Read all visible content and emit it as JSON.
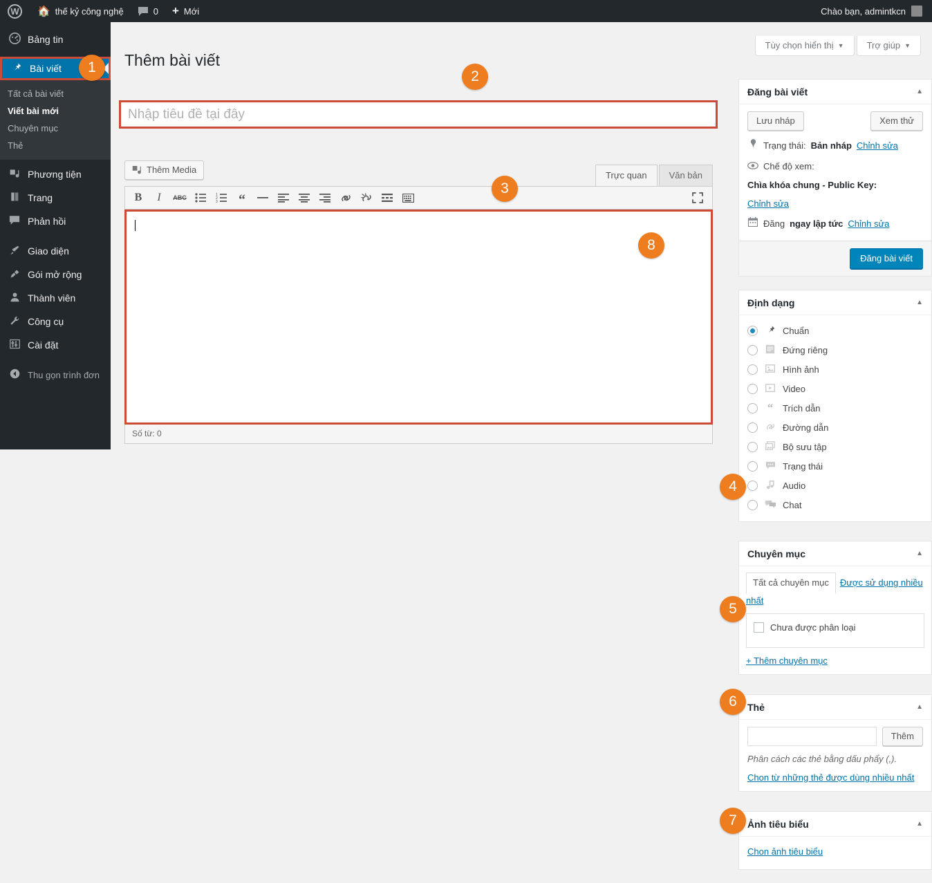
{
  "adminbar": {
    "logo_icon": "wordpress-logo-icon",
    "site_icon": "home-icon",
    "site_name": "thế kỷ công nghệ",
    "comments_icon": "comment-bubble-icon",
    "comments_count": "0",
    "new_icon": "plus-icon",
    "new_label": "Mới",
    "greeting": "Chào bạn, admintkcn"
  },
  "sidebar": {
    "items": [
      {
        "label": "Bảng tin",
        "icon": "dashboard-icon"
      },
      {
        "label": "Bài viết",
        "icon": "pin-icon"
      },
      {
        "label": "Phương tiện",
        "icon": "media-icon"
      },
      {
        "label": "Trang",
        "icon": "page-icon"
      },
      {
        "label": "Phản hồi",
        "icon": "comment-icon"
      },
      {
        "label": "Giao diện",
        "icon": "appearance-brush-icon"
      },
      {
        "label": "Gói mở rộng",
        "icon": "plugin-plug-icon"
      },
      {
        "label": "Thành viên",
        "icon": "user-icon"
      },
      {
        "label": "Công cụ",
        "icon": "wrench-icon"
      },
      {
        "label": "Cài đặt",
        "icon": "settings-sliders-icon"
      },
      {
        "label": "Thu gọn trình đơn",
        "icon": "collapse-arrow-icon"
      }
    ],
    "submenu": [
      {
        "label": "Tất cả bài viết",
        "current": false
      },
      {
        "label": "Viết bài mới",
        "current": true
      },
      {
        "label": "Chuyên mục",
        "current": false
      },
      {
        "label": "Thẻ",
        "current": false
      }
    ]
  },
  "screen_meta": {
    "screen_options": "Tùy chọn hiển thị",
    "help": "Trợ giúp",
    "caret": "▼"
  },
  "page": {
    "title": "Thêm bài viết",
    "title_placeholder": "Nhập tiêu đề tại đây",
    "title_value": ""
  },
  "editor": {
    "add_media": "Thêm Media",
    "add_media_icon": "media-add-icon",
    "tab_visual": "Trực quan",
    "tab_text": "Văn bản",
    "fullscreen_icon": "fullscreen-expand-icon",
    "toolbar_buttons": [
      {
        "name": "bold-icon",
        "glyph": "B"
      },
      {
        "name": "italic-icon",
        "glyph": "I"
      },
      {
        "name": "strikethrough-icon",
        "glyph": "ABC"
      },
      {
        "name": "bulleted-list-icon",
        "glyph": ""
      },
      {
        "name": "numbered-list-icon",
        "glyph": ""
      },
      {
        "name": "blockquote-icon",
        "glyph": "“"
      },
      {
        "name": "horizontal-rule-icon",
        "glyph": "—"
      },
      {
        "name": "align-left-icon",
        "glyph": ""
      },
      {
        "name": "align-center-icon",
        "glyph": ""
      },
      {
        "name": "align-right-icon",
        "glyph": ""
      },
      {
        "name": "insert-link-icon",
        "glyph": ""
      },
      {
        "name": "remove-link-icon",
        "glyph": ""
      },
      {
        "name": "read-more-icon",
        "glyph": ""
      },
      {
        "name": "keyboard-shortcuts-icon",
        "glyph": ""
      }
    ],
    "content": "",
    "word_count": "Số từ: 0"
  },
  "publish_box": {
    "title": "Đăng bài viết",
    "save_draft": "Lưu nháp",
    "preview": "Xem thử",
    "status_icon": "pin-status-icon",
    "status_label": "Trạng thái:",
    "status_value": "Bản nháp",
    "status_edit": "Chỉnh sửa",
    "visibility_icon": "eye-icon",
    "visibility_label": "Chế độ xem:",
    "visibility_value": "Chìa khóa chung - Public Key:",
    "visibility_edit": "Chỉnh sửa",
    "schedule_icon": "calendar-icon",
    "schedule_label": "Đăng",
    "schedule_value": "ngay lập tức",
    "schedule_edit": "Chỉnh sửa",
    "publish_button": "Đăng bài viết"
  },
  "format_box": {
    "title": "Định dạng",
    "options": [
      {
        "label": "Chuẩn",
        "icon": "pin-icon",
        "selected": true
      },
      {
        "label": "Đứng riêng",
        "icon": "aside-note-icon",
        "selected": false
      },
      {
        "label": "Hình ảnh",
        "icon": "image-icon",
        "selected": false
      },
      {
        "label": "Video",
        "icon": "video-icon",
        "selected": false
      },
      {
        "label": "Trích dẫn",
        "icon": "quote-icon",
        "selected": false
      },
      {
        "label": "Đường dẫn",
        "icon": "link-icon",
        "selected": false
      },
      {
        "label": "Bộ sưu tập",
        "icon": "gallery-icon",
        "selected": false
      },
      {
        "label": "Trạng thái",
        "icon": "status-bubble-icon",
        "selected": false
      },
      {
        "label": "Audio",
        "icon": "audio-note-icon",
        "selected": false
      },
      {
        "label": "Chat",
        "icon": "chat-bubbles-icon",
        "selected": false
      }
    ]
  },
  "category_box": {
    "title": "Chuyên mục",
    "tab_all": "Tất cả chuyên mục",
    "tab_most_used": "Được sử dụng nhiều nhất",
    "items": [
      {
        "label": "Chưa được phân loại",
        "checked": false
      }
    ],
    "add_link": "+ Thêm chuyên mục"
  },
  "tag_box": {
    "title": "Thẻ",
    "input_value": "",
    "add_button": "Thêm",
    "hint": "Phân cách các thẻ bằng dấu phẩy (,).",
    "choose_link": "Chon từ những thẻ được dùng nhiều nhất"
  },
  "featured_box": {
    "title": "Ảnh tiêu biểu",
    "link": "Chon ảnh tiêu biểu"
  },
  "annotations": {
    "badges": [
      "1",
      "2",
      "3",
      "4",
      "5",
      "6",
      "7",
      "8"
    ],
    "badge_color": "#ed7d1e",
    "highlight_color": "#cc4b37"
  }
}
